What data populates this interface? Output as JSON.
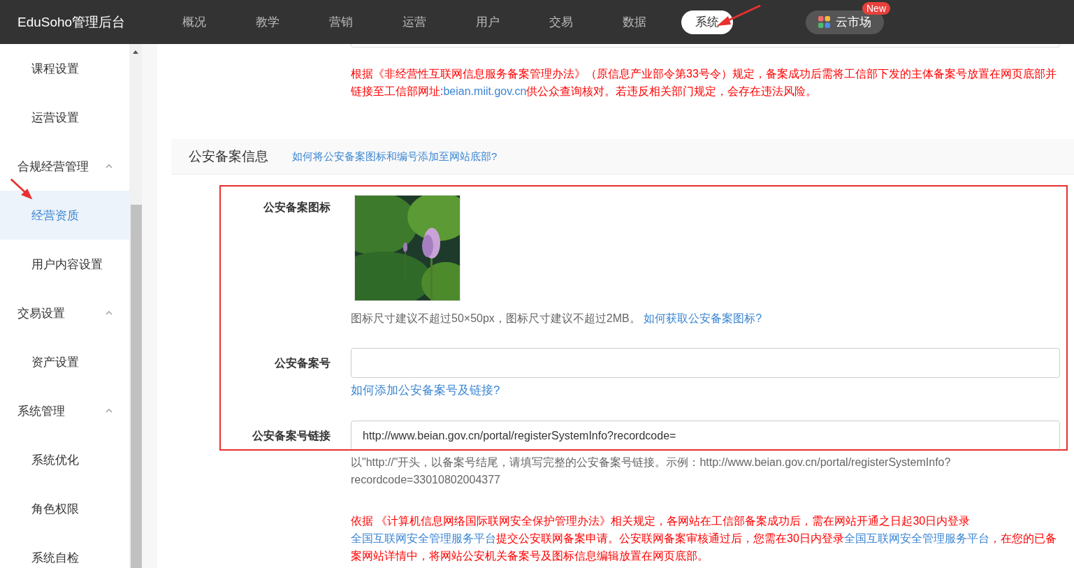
{
  "nav": {
    "brand": "EduSoho管理后台",
    "items": [
      {
        "label": "概况",
        "selected": false
      },
      {
        "label": "教学",
        "selected": false
      },
      {
        "label": "营销",
        "selected": false
      },
      {
        "label": "运营",
        "selected": false
      },
      {
        "label": "用户",
        "selected": false
      },
      {
        "label": "交易",
        "selected": false
      },
      {
        "label": "数据",
        "selected": false
      },
      {
        "label": "系统",
        "selected": true
      }
    ],
    "market": {
      "label": "云市场",
      "badge": "New"
    }
  },
  "sidebar": {
    "items": [
      {
        "label": "课程设置",
        "selected": false
      },
      {
        "label": "运营设置",
        "selected": false
      }
    ],
    "groups": [
      {
        "label": "合规经营管理",
        "expanded": true,
        "children": [
          {
            "label": "经营资质",
            "selected": true
          },
          {
            "label": "用户内容设置",
            "selected": false
          }
        ]
      },
      {
        "label": "交易设置",
        "expanded": true,
        "children": [
          {
            "label": "资产设置",
            "selected": false
          }
        ]
      },
      {
        "label": "系统管理",
        "expanded": true,
        "children": [
          {
            "label": "系统优化",
            "selected": false
          },
          {
            "label": "角色权限",
            "selected": false
          },
          {
            "label": "系统自检",
            "selected": false
          }
        ]
      }
    ]
  },
  "notice_top": [
    {
      "kind": "text",
      "text": "根据《非经营性互联网信息服务备案管理办法》（原信息产业部令第33号令）规定，备案成功后需将工信部下发的主体备案号放置在网页底部并链接至工信部网址:"
    },
    {
      "kind": "link",
      "text": "beian.miit.gov.cn"
    },
    {
      "kind": "text",
      "text": "供公众查询核对。若违反相关部门规定，会存在违法风险。"
    }
  ],
  "section": {
    "title": "公安备案信息",
    "help_link": "如何将公安备案图标和编号添加至网站底部?"
  },
  "fields": [
    {
      "label": "公安备案图标",
      "hint": "图标尺寸建议不超过50×50px，图标尺寸建议不超过2MB。",
      "help_link": "如何获取公安备案图标?"
    },
    {
      "kind": "input",
      "label": "公安备案号",
      "help_link": "如何添加公安备案号及链接?"
    },
    {
      "kind": "input",
      "label": "公安备案号链接",
      "value": "http://www.beian.gov.cn/portal/registerSystemInfo?recordcode=",
      "hint": "以\"http://\"开头，以备案号结尾，请填写完整的公安备案号链接。示例：http://www.beian.gov.cn/portal/registerSystemInfo?recordcode=33010802004377"
    }
  ],
  "notice_bottom": [
    {
      "kind": "text",
      "text": "依据 《计算机信息网络国际联网安全保护管理办法》相关规定，各网站在工信部备案成功后，需在网站开通之日起30日内登录"
    },
    {
      "kind": "link",
      "text": "全国互联网安全管理服务平台"
    },
    {
      "kind": "text",
      "text": "提交公安联网备案申请。公安联网备案审核通过后，您需在30日内登录"
    },
    {
      "kind": "link",
      "text": "全国互联网安全管理服务平台"
    },
    {
      "kind": "text",
      "text": "，在您的已备案网站详情中，将网站公安机关备案号及图标信息编辑放置在网页底部。"
    }
  ]
}
